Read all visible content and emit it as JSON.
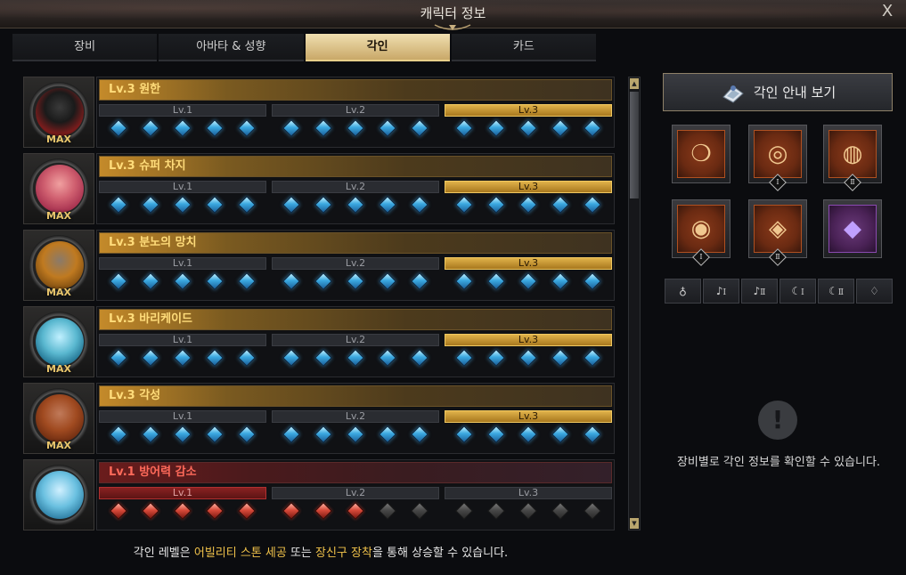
{
  "window": {
    "title": "캐릭터 정보",
    "close_label": "X"
  },
  "tabs": [
    {
      "label": "장비",
      "active": false
    },
    {
      "label": "아바타 & 성향",
      "active": false
    },
    {
      "label": "각인",
      "active": true
    },
    {
      "label": "카드",
      "active": false
    }
  ],
  "engravings": [
    {
      "title": "Lv.3 원한",
      "badge": "MAX",
      "state": "max",
      "portrait_icon": "wolf-beast-icon",
      "levels": [
        {
          "label": "Lv.1",
          "active": false,
          "gems": [
            "blue",
            "blue",
            "blue",
            "blue",
            "blue"
          ]
        },
        {
          "label": "Lv.2",
          "active": false,
          "gems": [
            "blue",
            "blue",
            "blue",
            "blue",
            "blue"
          ]
        },
        {
          "label": "Lv.3",
          "active": true,
          "gems": [
            "blue",
            "blue",
            "blue",
            "blue",
            "blue"
          ]
        }
      ]
    },
    {
      "title": "Lv.3 슈퍼 차지",
      "badge": "MAX",
      "state": "max",
      "portrait_icon": "muscle-man-icon",
      "levels": [
        {
          "label": "Lv.1",
          "active": false,
          "gems": [
            "blue",
            "blue",
            "blue",
            "blue",
            "blue"
          ]
        },
        {
          "label": "Lv.2",
          "active": false,
          "gems": [
            "blue",
            "blue",
            "blue",
            "blue",
            "blue"
          ]
        },
        {
          "label": "Lv.3",
          "active": true,
          "gems": [
            "blue",
            "blue",
            "blue",
            "blue",
            "blue"
          ]
        }
      ]
    },
    {
      "title": "Lv.3 분노의 망치",
      "badge": "MAX",
      "state": "max",
      "portrait_icon": "hammer-icon",
      "levels": [
        {
          "label": "Lv.1",
          "active": false,
          "gems": [
            "blue",
            "blue",
            "blue",
            "blue",
            "blue"
          ]
        },
        {
          "label": "Lv.2",
          "active": false,
          "gems": [
            "blue",
            "blue",
            "blue",
            "blue",
            "blue"
          ]
        },
        {
          "label": "Lv.3",
          "active": true,
          "gems": [
            "blue",
            "blue",
            "blue",
            "blue",
            "blue"
          ]
        }
      ]
    },
    {
      "title": "Lv.3 바리케이드",
      "badge": "MAX",
      "state": "max",
      "portrait_icon": "barricade-shield-icon",
      "levels": [
        {
          "label": "Lv.1",
          "active": false,
          "gems": [
            "blue",
            "blue",
            "blue",
            "blue",
            "blue"
          ]
        },
        {
          "label": "Lv.2",
          "active": false,
          "gems": [
            "blue",
            "blue",
            "blue",
            "blue",
            "blue"
          ]
        },
        {
          "label": "Lv.3",
          "active": true,
          "gems": [
            "blue",
            "blue",
            "blue",
            "blue",
            "blue"
          ]
        }
      ]
    },
    {
      "title": "Lv.3 각성",
      "badge": "MAX",
      "state": "max",
      "portrait_icon": "bald-warrior-icon",
      "levels": [
        {
          "label": "Lv.1",
          "active": false,
          "gems": [
            "blue",
            "blue",
            "blue",
            "blue",
            "blue"
          ]
        },
        {
          "label": "Lv.2",
          "active": false,
          "gems": [
            "blue",
            "blue",
            "blue",
            "blue",
            "blue"
          ]
        },
        {
          "label": "Lv.3",
          "active": true,
          "gems": [
            "blue",
            "blue",
            "blue",
            "blue",
            "blue"
          ]
        }
      ]
    },
    {
      "title": "Lv.1 방어력 감소",
      "badge": "",
      "state": "penalty",
      "portrait_icon": "cracked-shield-icon",
      "levels": [
        {
          "label": "Lv.1",
          "active": true,
          "gems": [
            "red",
            "red",
            "red",
            "red",
            "red"
          ]
        },
        {
          "label": "Lv.2",
          "active": false,
          "gems": [
            "red",
            "red",
            "red",
            "empty",
            "empty"
          ]
        },
        {
          "label": "Lv.3",
          "active": false,
          "gems": [
            "empty",
            "empty",
            "empty",
            "empty",
            "empty"
          ]
        }
      ]
    }
  ],
  "footer": {
    "prefix": "각인 레벨은 ",
    "hl1": "어빌리티 스톤 세공",
    "mid": " 또는 ",
    "hl2": "장신구 장착",
    "suffix": "을 통해 상승할 수 있습니다."
  },
  "guide_button": {
    "label": "각인 안내 보기",
    "icon": "book-icon"
  },
  "equipment": [
    {
      "icon": "necklace-icon",
      "badge": "",
      "bg": "orange"
    },
    {
      "icon": "earring-1-icon",
      "badge": "Ⅰ",
      "bg": "orange"
    },
    {
      "icon": "earring-2-icon",
      "badge": "Ⅱ",
      "bg": "orange"
    },
    {
      "icon": "ring-1-icon",
      "badge": "Ⅰ",
      "bg": "orange"
    },
    {
      "icon": "ring-2-icon",
      "badge": "Ⅱ",
      "bg": "orange"
    },
    {
      "icon": "ability-stone-icon",
      "badge": "",
      "bg": "purple"
    }
  ],
  "filters": [
    {
      "icon": "necklace-filter-icon",
      "suffix": ""
    },
    {
      "icon": "earring-filter-icon",
      "suffix": "Ⅰ"
    },
    {
      "icon": "earring-filter-icon",
      "suffix": "Ⅱ"
    },
    {
      "icon": "ring-filter-icon",
      "suffix": "Ⅰ"
    },
    {
      "icon": "ring-filter-icon",
      "suffix": "Ⅱ"
    },
    {
      "icon": "stone-filter-icon",
      "suffix": ""
    }
  ],
  "notice": {
    "icon_glyph": "!",
    "text": "장비별로 각인 정보를 확인할 수 있습니다."
  },
  "colors": {
    "accent_gold": "#e0b24a",
    "penalty_red": "#ff6a5a",
    "highlight": "#f0c24a"
  }
}
